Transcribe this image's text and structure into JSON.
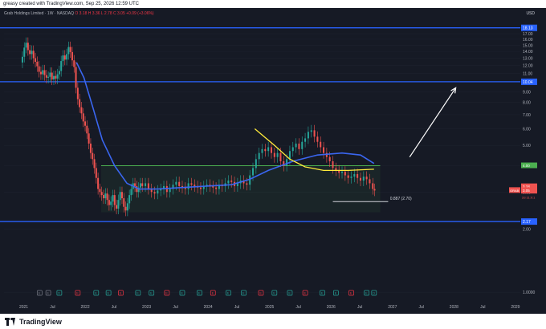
{
  "header": {
    "author_line": "greasy created with TradingView.com, Sep 25, 2026 12:59 UTC"
  },
  "legend": {
    "symbol": "Grab Holdings Limited · 1W · NASDAQ",
    "ohlc": "O 3.18  H 3.36  L 2.78  C 3.05  +0.09 (+3.06%)"
  },
  "currency": "USD",
  "footer": {
    "brand": "TradingView"
  },
  "colors": {
    "background": "#161a25",
    "up_candle": "#26a69a",
    "down_candle": "#ef5350",
    "level_line": "#2962ff",
    "ma_line": "#3a66f0",
    "yellow_line": "#ffeb3b",
    "green_zone": "#4caf50",
    "arrow": "#ffffff"
  },
  "chart_data": {
    "type": "candlestick",
    "scale": "log",
    "ylim": [
      0.95,
      21
    ],
    "x_ticks": [
      "2021",
      "Jul",
      "2022",
      "Jul",
      "2023",
      "Jul",
      "2024",
      "Jul",
      "2025",
      "Jul",
      "2026",
      "Jul",
      "2027",
      "Jul",
      "2028",
      "Jul",
      "2029"
    ],
    "y_ticks": [
      1.0,
      2.0,
      3.0,
      4.0,
      5.0,
      6.0,
      7.0,
      8.0,
      9.0,
      10.0,
      11.0,
      12.0,
      13.0,
      14.0,
      15.0,
      16.0,
      17.0
    ],
    "y_tick_labels": [
      "1.0000",
      "2.00",
      "3.00",
      "4.00",
      "5.00",
      "6.00",
      "7.00",
      "8.00",
      "9.00",
      "10.00",
      "11.00",
      "12.00",
      "13.00",
      "14.00",
      "15.00",
      "16.00",
      "17.00"
    ],
    "horizontal_levels": [
      {
        "value": 18.13,
        "label": "18.13"
      },
      {
        "value": 10.04,
        "label": "10.04"
      },
      {
        "value": 2.17,
        "label": "2.17"
      }
    ],
    "zone": {
      "low": 2.4,
      "high": 4.0
    },
    "price_labels": [
      {
        "value": 3.18,
        "label": "3.18",
        "color": "#ef5350"
      },
      {
        "value": 3.11,
        "label": "3.11",
        "color": "#ef5350"
      },
      {
        "value": 3.05,
        "label": "3.05",
        "color": "#ef5350"
      },
      {
        "value": 4.0,
        "label": "4.00",
        "color": "#4caf50"
      }
    ],
    "fib_label": "0.887 (2.70)",
    "ticker_tag": "GRAB",
    "close_countdown": "2d 11:0:1",
    "candles_weekly_close": [
      [
        2020.95,
        12.4
      ],
      [
        2021.0,
        13.2
      ],
      [
        2021.03,
        14.6
      ],
      [
        2021.06,
        15.4
      ],
      [
        2021.09,
        14.2
      ],
      [
        2021.12,
        13.6
      ],
      [
        2021.15,
        14.1
      ],
      [
        2021.18,
        13.0
      ],
      [
        2021.21,
        12.5
      ],
      [
        2021.24,
        11.9
      ],
      [
        2021.27,
        11.2
      ],
      [
        2021.3,
        10.9
      ],
      [
        2021.33,
        11.4
      ],
      [
        2021.36,
        10.8
      ],
      [
        2021.39,
        10.5
      ],
      [
        2021.42,
        10.6
      ],
      [
        2021.45,
        11.1
      ],
      [
        2021.48,
        10.3
      ],
      [
        2021.51,
        10.7
      ],
      [
        2021.54,
        10.4
      ],
      [
        2021.57,
        10.9
      ],
      [
        2021.6,
        11.3
      ],
      [
        2021.63,
        12.6
      ],
      [
        2021.66,
        13.4
      ],
      [
        2021.69,
        12.8
      ],
      [
        2021.72,
        13.6
      ],
      [
        2021.75,
        14.7
      ],
      [
        2021.78,
        13.9
      ],
      [
        2021.81,
        12.7
      ],
      [
        2021.84,
        11.8
      ],
      [
        2021.87,
        9.4
      ],
      [
        2021.9,
        8.3
      ],
      [
        2021.93,
        7.6
      ],
      [
        2021.96,
        7.1
      ],
      [
        2021.99,
        6.5
      ],
      [
        2022.02,
        6.2
      ],
      [
        2022.05,
        5.7
      ],
      [
        2022.08,
        5.1
      ],
      [
        2022.11,
        4.6
      ],
      [
        2022.14,
        4.3
      ],
      [
        2022.17,
        3.9
      ],
      [
        2022.2,
        3.5
      ],
      [
        2022.23,
        3.1
      ],
      [
        2022.26,
        3.0
      ],
      [
        2022.29,
        2.9
      ],
      [
        2022.32,
        2.8
      ],
      [
        2022.35,
        2.95
      ],
      [
        2022.38,
        2.75
      ],
      [
        2022.41,
        2.6
      ],
      [
        2022.44,
        2.7
      ],
      [
        2022.47,
        2.9
      ],
      [
        2022.5,
        2.6
      ],
      [
        2022.53,
        2.5
      ],
      [
        2022.56,
        2.75
      ],
      [
        2022.59,
        3.0
      ],
      [
        2022.62,
        2.8
      ],
      [
        2022.65,
        2.55
      ],
      [
        2022.68,
        2.45
      ],
      [
        2022.71,
        2.65
      ],
      [
        2022.74,
        2.9
      ],
      [
        2022.77,
        3.1
      ],
      [
        2022.8,
        3.3
      ],
      [
        2022.83,
        3.2
      ],
      [
        2022.86,
        3.0
      ],
      [
        2022.89,
        3.15
      ],
      [
        2022.92,
        3.3
      ],
      [
        2022.95,
        3.2
      ],
      [
        2023.0,
        3.3
      ],
      [
        2023.05,
        3.1
      ],
      [
        2023.1,
        3.0
      ],
      [
        2023.15,
        2.95
      ],
      [
        2023.2,
        3.05
      ],
      [
        2023.25,
        3.1
      ],
      [
        2023.3,
        3.2
      ],
      [
        2023.35,
        3.0
      ],
      [
        2023.4,
        3.1
      ],
      [
        2023.45,
        3.25
      ],
      [
        2023.5,
        3.35
      ],
      [
        2023.55,
        3.2
      ],
      [
        2023.6,
        3.15
      ],
      [
        2023.65,
        3.1
      ],
      [
        2023.7,
        3.3
      ],
      [
        2023.75,
        3.25
      ],
      [
        2023.8,
        3.2
      ],
      [
        2023.85,
        3.15
      ],
      [
        2023.9,
        3.1
      ],
      [
        2023.95,
        3.2
      ],
      [
        2024.0,
        3.25
      ],
      [
        2024.05,
        3.2
      ],
      [
        2024.1,
        3.15
      ],
      [
        2024.15,
        3.1
      ],
      [
        2024.2,
        3.25
      ],
      [
        2024.25,
        3.2
      ],
      [
        2024.3,
        3.3
      ],
      [
        2024.35,
        3.4
      ],
      [
        2024.4,
        3.35
      ],
      [
        2024.45,
        3.2
      ],
      [
        2024.5,
        3.3
      ],
      [
        2024.55,
        3.4
      ],
      [
        2024.6,
        3.3
      ],
      [
        2024.65,
        3.25
      ],
      [
        2024.7,
        3.6
      ],
      [
        2024.75,
        3.9
      ],
      [
        2024.8,
        4.3
      ],
      [
        2024.85,
        4.6
      ],
      [
        2024.9,
        4.8
      ],
      [
        2024.95,
        4.7
      ],
      [
        2025.0,
        4.9
      ],
      [
        2025.05,
        4.6
      ],
      [
        2025.1,
        4.4
      ],
      [
        2025.15,
        4.6
      ],
      [
        2025.2,
        4.2
      ],
      [
        2025.25,
        4.0
      ],
      [
        2025.3,
        4.3
      ],
      [
        2025.35,
        4.7
      ],
      [
        2025.4,
        4.9
      ],
      [
        2025.45,
        5.1
      ],
      [
        2025.5,
        4.8
      ],
      [
        2025.55,
        5.2
      ],
      [
        2025.6,
        5.4
      ],
      [
        2025.65,
        5.8
      ],
      [
        2025.7,
        5.9
      ],
      [
        2025.75,
        5.5
      ],
      [
        2025.8,
        5.2
      ],
      [
        2025.85,
        4.9
      ],
      [
        2025.9,
        4.6
      ],
      [
        2025.95,
        4.4
      ],
      [
        2026.0,
        4.2
      ],
      [
        2026.05,
        3.9
      ],
      [
        2026.1,
        3.8
      ],
      [
        2026.15,
        3.7
      ],
      [
        2026.2,
        3.75
      ],
      [
        2026.25,
        3.6
      ],
      [
        2026.3,
        3.5
      ],
      [
        2026.35,
        3.55
      ],
      [
        2026.4,
        3.65
      ],
      [
        2026.45,
        3.5
      ],
      [
        2026.5,
        3.4
      ],
      [
        2026.55,
        3.55
      ],
      [
        2026.6,
        3.45
      ],
      [
        2026.65,
        3.3
      ],
      [
        2026.7,
        3.1
      ],
      [
        2026.73,
        3.05
      ]
    ]
  }
}
